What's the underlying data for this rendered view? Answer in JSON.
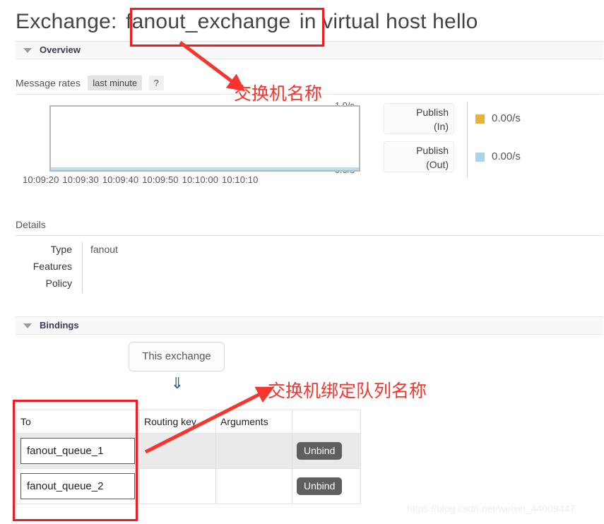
{
  "page": {
    "title_prefix": "Exchange:",
    "exchange_name": "fanout_exchange",
    "title_middle": "in virtual host",
    "vhost": "hello"
  },
  "sections": {
    "overview_label": "Overview",
    "bindings_label": "Bindings"
  },
  "rates": {
    "label": "Message rates",
    "period": "last minute",
    "help": "?"
  },
  "chart_data": {
    "type": "line",
    "title": "Message rates",
    "xlabel": "",
    "ylabel": "",
    "ylim": [
      0.0,
      1.0
    ],
    "y_ticks": [
      "0.0/s",
      "1.0/s"
    ],
    "y_tick_top": "1.0/s",
    "y_tick_bottom": "0.0/s",
    "x": [
      "10:09:20",
      "10:09:30",
      "10:09:40",
      "10:09:50",
      "10:10:00",
      "10:10:10"
    ],
    "grid": false,
    "legend_position": "right",
    "series": [
      {
        "name": "Publish (In)",
        "color": "#e8b33a",
        "value_label": "0.00/s",
        "values": [
          0,
          0,
          0,
          0,
          0,
          0
        ]
      },
      {
        "name": "Publish (Out)",
        "color": "#a8d4ef",
        "value_label": "0.00/s",
        "values": [
          0,
          0,
          0,
          0,
          0,
          0
        ]
      }
    ]
  },
  "legend": [
    {
      "button_line1": "Publish",
      "button_line2": "(In)",
      "swatch_color": "#e8b33a",
      "value": "0.00/s"
    },
    {
      "button_line1": "Publish",
      "button_line2": "(Out)",
      "swatch_color": "#a8d4ef",
      "value": "0.00/s"
    }
  ],
  "details": {
    "heading": "Details",
    "rows": [
      {
        "key": "Type",
        "value": "fanout"
      },
      {
        "key": "Features",
        "value": ""
      },
      {
        "key": "Policy",
        "value": ""
      }
    ]
  },
  "bindings": {
    "this_exchange_label": "This exchange",
    "down_arrow": "⇓",
    "columns": [
      "To",
      "Routing key",
      "Arguments",
      ""
    ],
    "rows": [
      {
        "to": "fanout_queue_1",
        "routing_key": "",
        "arguments": "",
        "action": "Unbind"
      },
      {
        "to": "fanout_queue_2",
        "routing_key": "",
        "arguments": "",
        "action": "Unbind"
      }
    ]
  },
  "annotations": [
    {
      "text": "交换机名称",
      "color": "#f5352e"
    },
    {
      "text": "交换机绑定队列名称",
      "color": "#f5352e"
    }
  ],
  "watermark": "https://blog.csdn.net/weixin_44009447"
}
